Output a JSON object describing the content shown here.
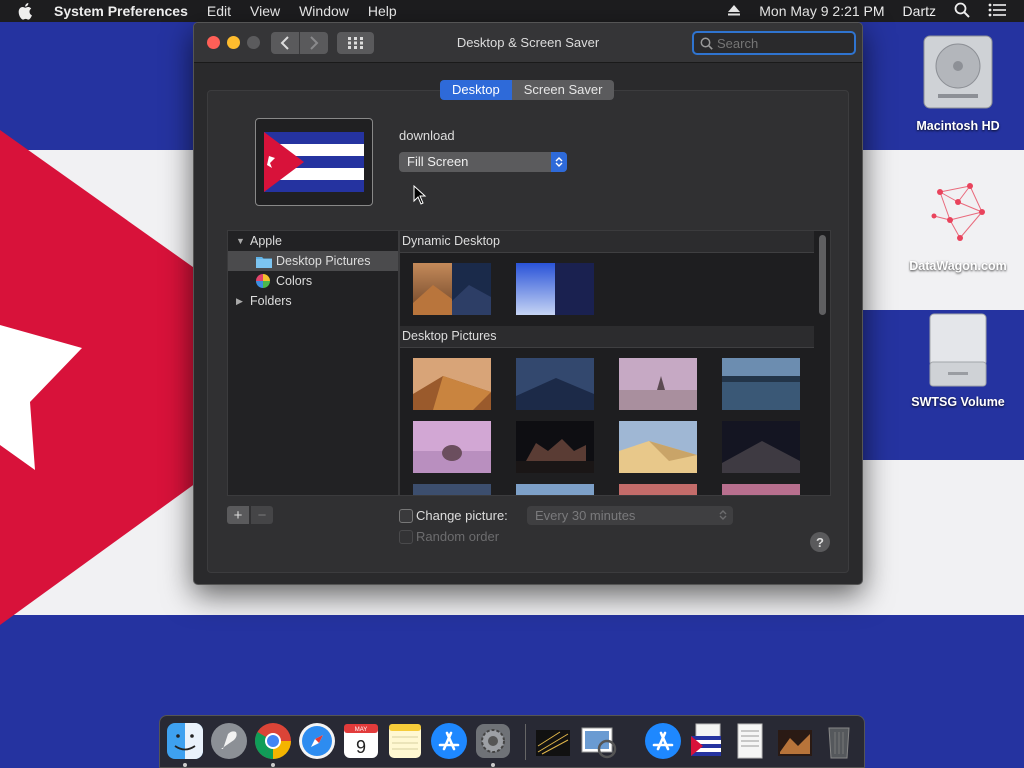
{
  "menubar": {
    "app_name": "System Preferences",
    "menus": [
      "Edit",
      "View",
      "Window",
      "Help"
    ],
    "clock": "Mon May 9  2:21 PM",
    "user": "Dartz"
  },
  "desktop_icons": [
    {
      "label": "Macintosh HD",
      "icon": "hard-drive-icon"
    },
    {
      "label": "DataWagon.com",
      "icon": "network-graph-icon"
    },
    {
      "label": "SWTSG Volume",
      "icon": "external-volume-icon"
    }
  ],
  "window": {
    "title": "Desktop & Screen Saver",
    "search_placeholder": "Search",
    "tabs": [
      {
        "label": "Desktop",
        "active": true
      },
      {
        "label": "Screen Saver",
        "active": false
      }
    ],
    "current_picture_name": "download",
    "fit_option": "Fill Screen",
    "source_list": [
      {
        "label": "Apple",
        "level": 0,
        "expanded": true,
        "icon": "disclosure-open-icon"
      },
      {
        "label": "Desktop Pictures",
        "level": 1,
        "selected": true,
        "icon": "folder-icon"
      },
      {
        "label": "Colors",
        "level": 1,
        "icon": "color-wheel-icon"
      },
      {
        "label": "Folders",
        "level": 0,
        "expanded": false,
        "icon": "disclosure-closed-icon"
      }
    ],
    "sections": [
      {
        "title": "Dynamic Desktop"
      },
      {
        "title": "Desktop Pictures"
      }
    ],
    "add_label": "+",
    "remove_label": "−",
    "change_picture_label": "Change picture:",
    "change_picture_checked": false,
    "interval_value": "Every 30 minutes",
    "random_order_label": "Random order",
    "help_label": "?"
  },
  "dock": {
    "apps": [
      "Finder",
      "Launchpad",
      "Google Chrome",
      "Safari",
      "Calendar",
      "Notes",
      "App Store",
      "System Preferences"
    ],
    "calendar_month": "MAY",
    "calendar_day": "9"
  },
  "colors": {
    "accent": "#2e6ad9",
    "flag_blue": "#2533a0",
    "flag_red": "#d8123a"
  }
}
